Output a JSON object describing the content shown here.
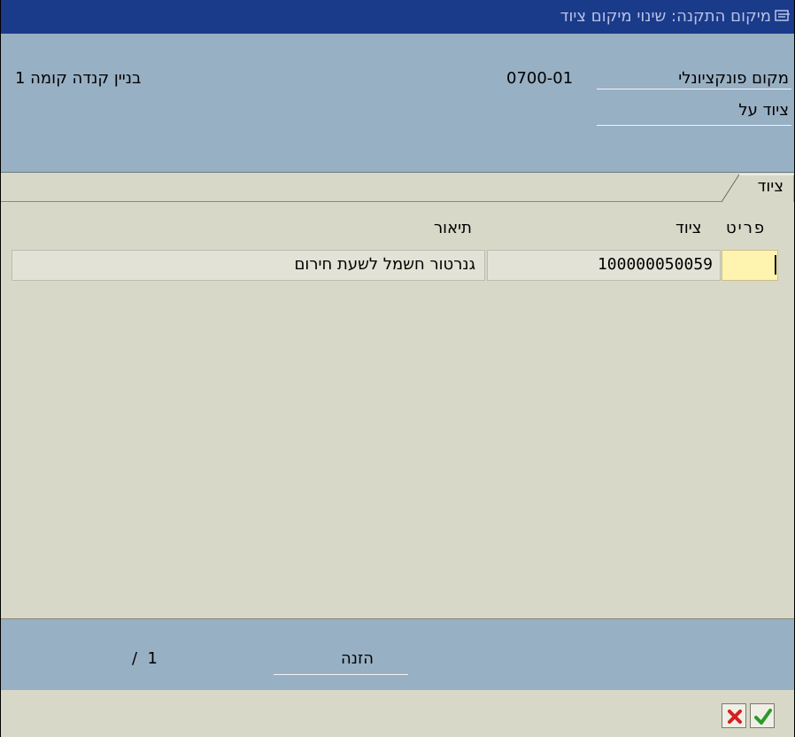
{
  "window": {
    "title": "מיקום התקנה: שינוי מיקום ציוד"
  },
  "header": {
    "functional_location_label": "מקום פונקציונלי",
    "functional_location_value": "0700-01",
    "functional_location_description": "בניין קנדה קומה 1",
    "superior_equipment_label": "ציוד על"
  },
  "tab": {
    "label": "ציוד"
  },
  "table": {
    "columns": [
      "פריט",
      "ציוד",
      "תיאור"
    ],
    "rows": [
      {
        "item": "",
        "equipment": "100000050059",
        "description": "גנרטור חשמל לשעת חירום"
      }
    ]
  },
  "footer": {
    "entry_label": "הזנה",
    "page_counter": "/  1"
  },
  "buttons": {
    "cancel_icon": "cancel-icon",
    "confirm_icon": "checkmark-icon"
  },
  "colors": {
    "titlebar": "#1a3a8a",
    "header_bg": "#98b0c4",
    "panel_bg": "#d8d8c8",
    "input_highlight": "#fff3b0",
    "cancel_red": "#d22020",
    "confirm_green": "#2a9a2a"
  }
}
